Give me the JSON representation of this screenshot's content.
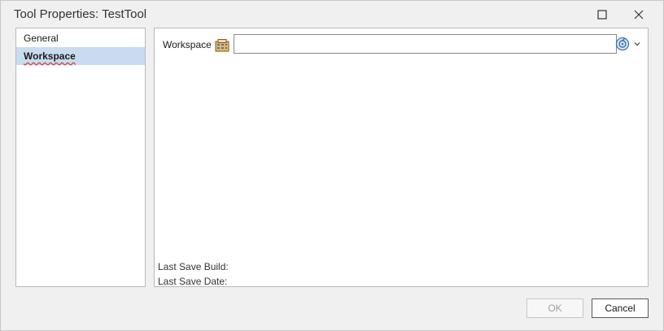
{
  "window": {
    "title": "Tool Properties: TestTool"
  },
  "sidebar": {
    "items": [
      {
        "label": "General",
        "selected": false
      },
      {
        "label": "Workspace",
        "selected": true
      }
    ]
  },
  "main": {
    "workspace_label": "Workspace",
    "workspace_value": "",
    "last_save_build_label": "Last Save Build:",
    "last_save_date_label": "Last Save Date:"
  },
  "footer": {
    "ok_label": "OK",
    "cancel_label": "Cancel"
  },
  "colors": {
    "selection": "#c9dcef",
    "spellcheck_underline": "#dd3333"
  }
}
